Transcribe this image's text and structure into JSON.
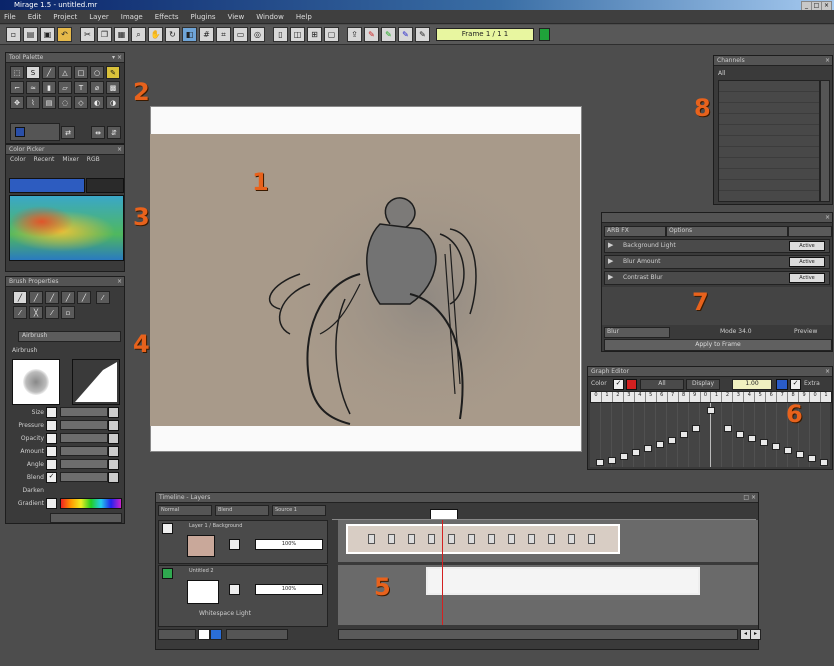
{
  "window": {
    "title": "Mirage 1.5 - untitled.mr"
  },
  "menu": [
    "File",
    "Edit",
    "Project",
    "Layer",
    "Image",
    "Effects",
    "Plugins",
    "View",
    "Window",
    "Help"
  ],
  "toolbar": {
    "frame_field": "Frame 1 / 1 1"
  },
  "callouts": [
    "1",
    "2",
    "3",
    "4",
    "5",
    "6",
    "7",
    "8"
  ],
  "tools_panel": {
    "title": "Tool Palette"
  },
  "color_panel": {
    "title": "Color Picker",
    "tabs": [
      "Color",
      "Recent",
      "Mixer",
      "RGB"
    ]
  },
  "brush_panel": {
    "title": "Brush Properties",
    "preset": "Airbrush",
    "section": "Airbrush",
    "rows": [
      "Size",
      "Pressure",
      "Opacity",
      "Amount",
      "Angle",
      "Blend",
      "Darken",
      "Gradient"
    ]
  },
  "effects_panel": {
    "tabs": [
      "ARB FX",
      "Options"
    ],
    "items": [
      "Background Light",
      "Blur Amount",
      "Contrast Blur"
    ],
    "item_value": "Active",
    "bottom_select": "Blur",
    "bottom_label": "Mode 34.0",
    "preview_label": "Preview",
    "apply_label": "Apply to Frame"
  },
  "graph_panel": {
    "title": "Graph Editor",
    "color_label": "Color",
    "all_btn": "All",
    "display_btn": "Display",
    "offset_btn": "Offset",
    "value": "1.00",
    "extra_label": "Extra",
    "ticks": [
      "0",
      "1",
      "2",
      "3",
      "4",
      "5",
      "6",
      "7",
      "8",
      "9",
      "0",
      "1",
      "2",
      "3",
      "4",
      "5",
      "6",
      "7",
      "8",
      "9",
      "0",
      "1"
    ]
  },
  "timeline_panel": {
    "title": "Timeline - Layers",
    "layers": [
      {
        "name": "Layer 1 / Background",
        "mode": "100%"
      },
      {
        "name": "Untitled 2",
        "mode": "100%",
        "caption": "Whitespace Light"
      }
    ],
    "fields": [
      "Normal",
      "Blend",
      "Source 1"
    ]
  },
  "right_panel": {
    "title": "Channels",
    "tab": "All"
  }
}
